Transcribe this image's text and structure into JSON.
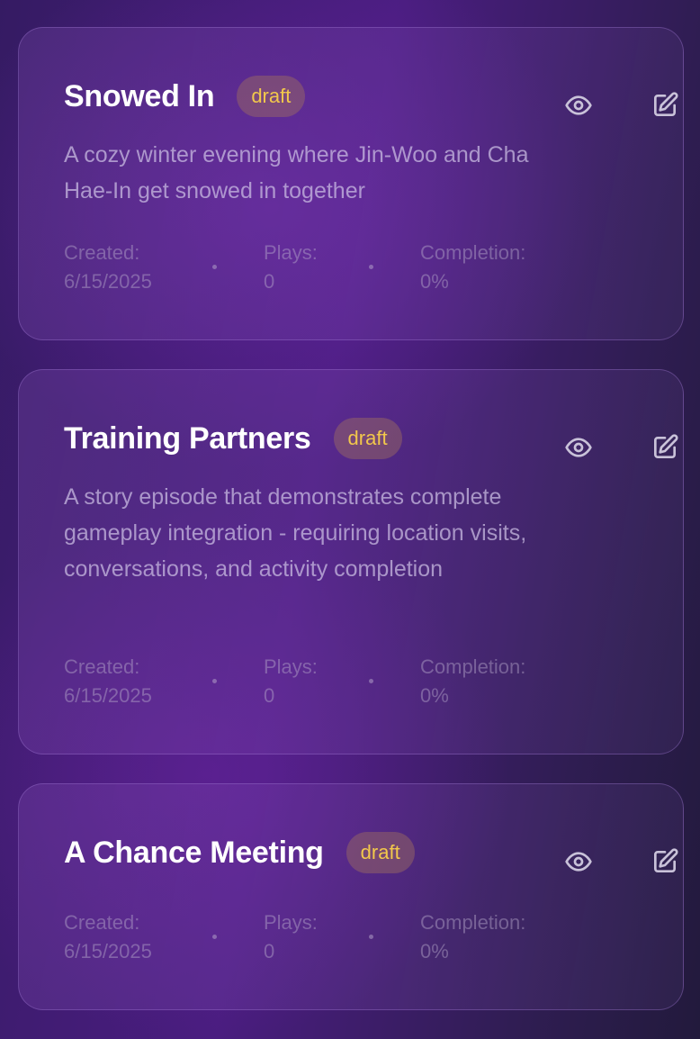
{
  "episodes": [
    {
      "title": "Snowed In",
      "status": "draft",
      "description": "A cozy winter evening where Jin-Woo and Cha Hae-In get snowed in together",
      "created_label": "Created:",
      "created_value": "6/15/2025",
      "plays_label": "Plays:",
      "plays_value": "0",
      "completion_label": "Completion:",
      "completion_value": "0%"
    },
    {
      "title": "Training Partners",
      "status": "draft",
      "description": "A story episode that demonstrates complete gameplay integration - requiring location visits, conversations, and activity completion",
      "created_label": "Created:",
      "created_value": "6/15/2025",
      "plays_label": "Plays:",
      "plays_value": "0",
      "completion_label": "Completion:",
      "completion_value": "0%"
    },
    {
      "title": "A Chance Meeting",
      "status": "draft",
      "created_label": "Created:",
      "created_value": "6/15/2025",
      "plays_label": "Plays:",
      "plays_value": "0",
      "completion_label": "Completion:",
      "completion_value": "0%"
    }
  ],
  "icons": {
    "view": "eye-icon",
    "edit": "edit-icon"
  },
  "colors": {
    "badge_text": "#f2c84b",
    "title_text": "#ffffff",
    "icon_stroke": "#c9c2d9"
  }
}
